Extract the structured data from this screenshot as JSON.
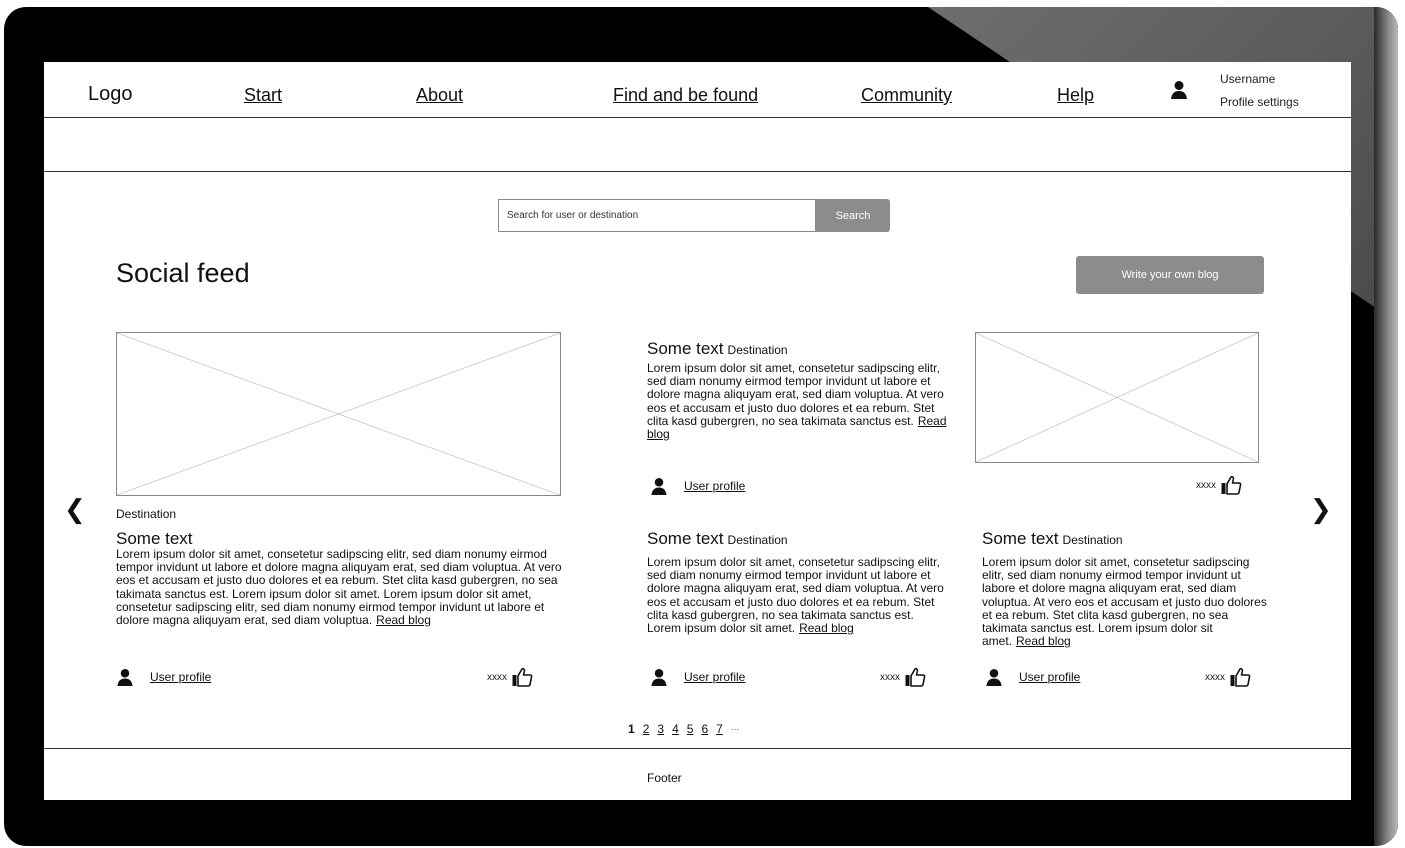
{
  "header": {
    "logo": "Logo",
    "nav": [
      {
        "label": "Start"
      },
      {
        "label": "About"
      },
      {
        "label": "Find and be found"
      },
      {
        "label": "Community"
      },
      {
        "label": "Help"
      }
    ],
    "username": "Username",
    "profile_settings": "Profile settings",
    "user_icon": "user-icon"
  },
  "search": {
    "placeholder": "Search for user or destination",
    "button": "Search"
  },
  "feed": {
    "title": "Social feed",
    "write_button": "Write your own blog",
    "prev_icon": "chevron-left-icon",
    "next_icon": "chevron-right-icon"
  },
  "posts": [
    {
      "destination_label": "Destination",
      "title": "Some text",
      "body": "Lorem ipsum dolor sit amet, consetetur sadipscing elitr, sed diam nonumy eirmod tempor invidunt ut labore et dolore magna aliquyam erat, sed diam voluptua. At vero eos et accusam et justo duo dolores et ea rebum. Stet clita kasd gubergren, no sea takimata sanctus est. Lorem ipsum dolor sit amet. Lorem ipsum dolor sit amet, consetetur sadipscing elitr, sed diam nonumy eirmod tempor invidunt ut labore et dolore magna aliquyam erat, sed diam voluptua.",
      "read_blog": "Read blog",
      "user_profile": "User profile",
      "likes": "xxxx"
    },
    {
      "title": "Some text",
      "destination": "Destination",
      "body": "Lorem ipsum dolor sit amet, consetetur sadipscing elitr, sed diam nonumy eirmod tempor invidunt ut labore et dolore magna aliquyam erat, sed diam voluptua. At vero eos et accusam et justo duo dolores et ea rebum. Stet clita kasd gubergren, no sea takimata sanctus est.",
      "read_blog": "Read blog",
      "user_profile": "User profile"
    },
    {
      "likes": "xxxx"
    },
    {
      "title": "Some text",
      "destination": "Destination",
      "body": "Lorem ipsum dolor sit amet, consetetur sadipscing elitr, sed diam nonumy eirmod tempor invidunt ut labore et dolore magna aliquyam erat, sed diam voluptua. At vero eos et accusam et justo duo dolores et ea rebum.  Stet clita kasd gubergren, no sea takimata sanctus est. Lorem ipsum dolor sit amet.",
      "read_blog": "Read blog",
      "user_profile": "User profile",
      "likes": "xxxx"
    },
    {
      "title": "Some text",
      "destination": "Destination",
      "body": "Lorem ipsum dolor sit amet, consetetur sadipscing elitr, sed diam nonumy eirmod tempor invidunt ut labore et dolore magna aliquyam erat, sed diam voluptua. At vero eos et accusam et justo duo dolores et ea rebum.  Stet clita kasd gubergren, no sea takimata sanctus est. Lorem ipsum dolor sit amet.",
      "read_blog": "Read blog",
      "user_profile": "User profile",
      "likes": "xxxx"
    }
  ],
  "pagination": {
    "current": "1",
    "pages": [
      "2",
      "3",
      "4",
      "5",
      "6",
      "7"
    ],
    "more": "..."
  },
  "footer": {
    "text": "Footer"
  },
  "icons": {
    "user": "user-icon",
    "like": "thumbs-up-icon",
    "image": "image-placeholder"
  }
}
